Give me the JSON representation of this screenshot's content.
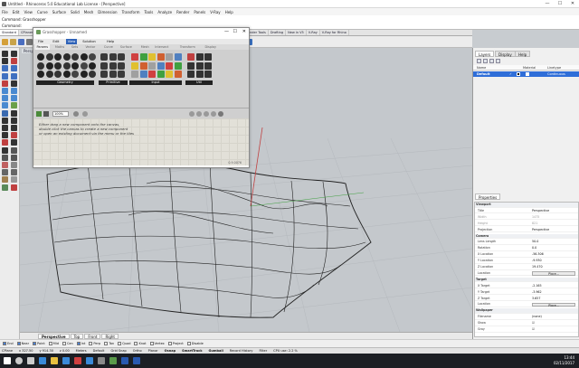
{
  "app": {
    "title": "Untitled - Rhinoceros 5.0 Educational Lab License - [Perspective]",
    "menu": [
      "File",
      "Edit",
      "View",
      "Curve",
      "Surface",
      "Solid",
      "Mesh",
      "Dimension",
      "Transform",
      "Tools",
      "Analyze",
      "Render",
      "Panels",
      "V-Ray",
      "Help"
    ]
  },
  "command": {
    "history": "Command: Grasshopper",
    "prompt": "Command:",
    "value": "",
    "placeholder": ""
  },
  "toolbar_tabs": [
    "Standard",
    "CPlanes",
    "Set View",
    "Display",
    "Select",
    "Viewport Layout",
    "Visibility",
    "Transform",
    "Curve Tools",
    "Surface Tools",
    "Solid Tools",
    "Mesh Tools",
    "Render Tools",
    "Drafting",
    "New in V5",
    "V-Ray",
    "V-Ray for Rhino"
  ],
  "viewport": {
    "label": "Perspective",
    "tabs": [
      "Perspective",
      "Top",
      "Front",
      "Right"
    ]
  },
  "osnaps": [
    {
      "label": "End",
      "on": true
    },
    {
      "label": "Near",
      "on": true
    },
    {
      "label": "Point",
      "on": true
    },
    {
      "label": "Mid",
      "on": false
    },
    {
      "label": "Cen",
      "on": false
    },
    {
      "label": "Int",
      "on": true
    },
    {
      "label": "Perp",
      "on": false
    },
    {
      "label": "Tan",
      "on": false
    },
    {
      "label": "Quad",
      "on": false
    },
    {
      "label": "Knot",
      "on": false
    },
    {
      "label": "Vertex",
      "on": false
    },
    {
      "label": "Project",
      "on": false
    },
    {
      "label": "Disable",
      "on": false
    }
  ],
  "status": {
    "cplane": "CPlane",
    "x": "x 327.50",
    "y": "y 914.30",
    "z": "z 0.00",
    "units": "Meters",
    "layer": "Default",
    "toggles": [
      "Grid Snap",
      "Ortho",
      "Planar",
      "Osnap",
      "SmartTrack",
      "Gumball",
      "Record History",
      "Filter",
      "CPU use: 2.2 %"
    ]
  },
  "taskbar": {
    "time": "13:44",
    "date": "02/11/2017"
  },
  "panels": {
    "tabs": [
      "Layers",
      "Display",
      "Help"
    ],
    "layers_headers": [
      "Name",
      "Material",
      "Linetype"
    ],
    "layer_row": {
      "name": "Default",
      "linetype": "Continuous"
    },
    "properties_tab": "Properties",
    "properties": [
      {
        "k": "Viewport",
        "type": "section"
      },
      {
        "k": "Title",
        "v": "Perspective"
      },
      {
        "k": "Width",
        "v": "1475",
        "grey": true
      },
      {
        "k": "Height",
        "v": "821",
        "grey": true
      },
      {
        "k": "Projection",
        "v": "Perspective"
      },
      {
        "k": "Camera",
        "type": "section"
      },
      {
        "k": "Lens Length",
        "v": "50.0"
      },
      {
        "k": "Rotation",
        "v": "0.0"
      },
      {
        "k": "X Location",
        "v": "-56.306"
      },
      {
        "k": "Y Location",
        "v": "-9.930"
      },
      {
        "k": "Z Location",
        "v": "19.470"
      },
      {
        "k": "Location",
        "button": "Place..."
      },
      {
        "k": "Target",
        "type": "section"
      },
      {
        "k": "X Target",
        "v": "-2.165"
      },
      {
        "k": "Y Target",
        "v": "-3.962"
      },
      {
        "k": "Z Target",
        "v": "3.657"
      },
      {
        "k": "Location",
        "button": "Place..."
      },
      {
        "k": "Wallpaper",
        "type": "section"
      },
      {
        "k": "Filename",
        "v": "(none)"
      },
      {
        "k": "Show",
        "v": "☑"
      },
      {
        "k": "Gray",
        "v": "☑"
      }
    ]
  },
  "grasshopper": {
    "title": "Grasshopper - Unnamed",
    "menu": [
      "File",
      "Edit",
      "View",
      "Solution",
      "Help"
    ],
    "tabs": [
      "Params",
      "Maths",
      "Sets",
      "Vector",
      "Curve",
      "Surface",
      "Mesh",
      "Intersect",
      "Transform",
      "Display"
    ],
    "groups": [
      "Geometry",
      "Primitive",
      "Input",
      "Util"
    ],
    "zoom": "100%",
    "hint": [
      "Either drag a new component onto the canvas,",
      "double click the canvas to create a new component",
      "or open an existing document via the menu or the tiles"
    ],
    "version": "0.9.0076"
  },
  "colors": {
    "accent": "#2f6ed8",
    "viewport_bg": "#c4c8cc",
    "surface_wire": "#222222",
    "axis_red": "#c04040"
  }
}
